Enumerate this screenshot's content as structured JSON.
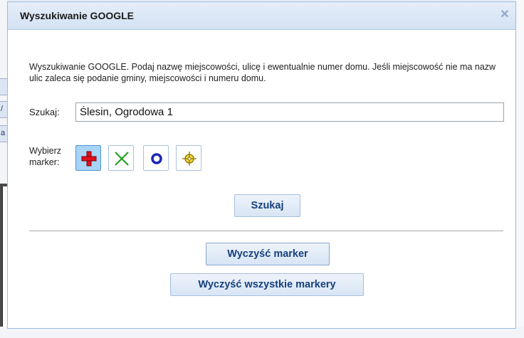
{
  "dialog": {
    "title": "Wyszukiwanie GOOGLE",
    "close_icon": "close-icon",
    "description": "Wyszukiwanie GOOGLE. Podaj nazwę miejscowości, ulicę i ewentualnie numer domu. Jeśli miejscowość nie ma nazw ulic zaleca się podanie gminy, miejscowości i numeru domu.",
    "search": {
      "label": "Szukaj:",
      "value": "Ślesin, Ogrodowa 1"
    },
    "marker": {
      "label_line1": "Wybierz",
      "label_line2": "marker:",
      "options": [
        {
          "icon": "red-cross-icon",
          "color": "#e0101c",
          "selected": true
        },
        {
          "icon": "green-x-icon",
          "color": "#22a022",
          "selected": false
        },
        {
          "icon": "blue-circle-icon",
          "color": "#1c24b8",
          "selected": false
        },
        {
          "icon": "yellow-crosshair-icon",
          "color": "#e8c400",
          "selected": false
        }
      ]
    },
    "buttons": {
      "search": "Szukaj",
      "clear_marker": "Wyczyść marker",
      "clear_all_markers": "Wyczyść wszystkie markery"
    }
  },
  "background": {
    "fragments": [
      "/",
      "a"
    ]
  }
}
